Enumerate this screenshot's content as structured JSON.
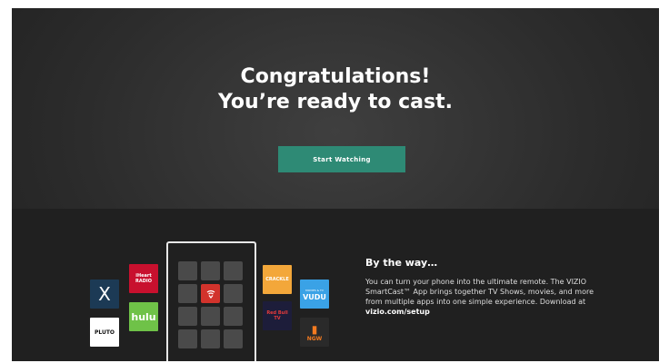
{
  "hero": {
    "line1": "Congratulations!",
    "line2": "You’re ready to cast.",
    "button_label": "Start Watching"
  },
  "info": {
    "title": "By the way…",
    "body": "You can turn your phone into the ultimate remote. The VIZIO SmartCast™ App brings together TV Shows, movies, and more from multiple apps into one simple experience. Download at ",
    "link": "vizio.com/setup"
  },
  "apps": {
    "xumo": "X",
    "iheart_1": "iHeart",
    "iheart_2": "RADIO",
    "pluto": "PLUTO",
    "hulu": "hulu",
    "crackle": "CRACKLE",
    "vudu_top": "MOVIES & TV",
    "vudu": "VUDU",
    "redbull_1": "Red Bull",
    "redbull_2": "TV",
    "ngw": "NGW"
  },
  "colors": {
    "accent": "#2e8a75",
    "background": "#2c2c2c"
  }
}
